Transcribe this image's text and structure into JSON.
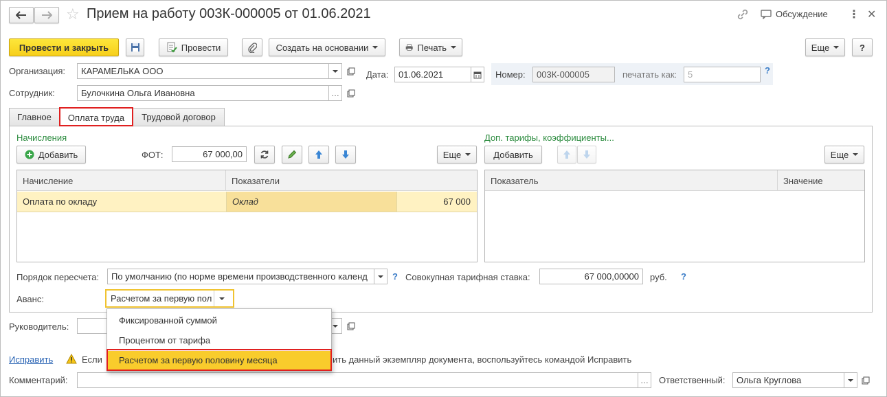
{
  "window": {
    "title": "Прием на работу 003К-000005 от 01.06.2021",
    "discussion_label": "Обсуждение"
  },
  "toolbar": {
    "post_close": "Провести и закрыть",
    "post": "Провести",
    "create_based": "Создать на основании",
    "print": "Печать",
    "more": "Еще",
    "help": "?"
  },
  "header": {
    "org_label": "Организация:",
    "org_value": "КАРАМЕЛЬКА ООО",
    "date_label": "Дата:",
    "date_value": "01.06.2021",
    "number_label": "Номер:",
    "number_value": "003К-000005",
    "print_as_label": "печатать как:",
    "print_as_value": "5",
    "help": "?",
    "employee_label": "Сотрудник:",
    "employee_value": "Булочкина Ольга Ивановна"
  },
  "tabs": [
    {
      "label": "Главное"
    },
    {
      "label": "Оплата труда"
    },
    {
      "label": "Трудовой договор"
    }
  ],
  "accruals": {
    "title": "Начисления",
    "add_label": "Добавить",
    "fot_label": "ФОТ:",
    "fot_value": "67 000,00",
    "more_label": "Еще",
    "columns": [
      "Начисление",
      "Показатели"
    ],
    "rows": [
      {
        "name": "Оплата по окладу",
        "indicator": "Оклад",
        "value": "67 000"
      }
    ]
  },
  "tariffs": {
    "title": "Доп. тарифы, коэффициенты...",
    "add_label": "Добавить",
    "more_label": "Еще",
    "columns": [
      "Показатель",
      "Значение"
    ]
  },
  "recalc": {
    "label": "Порядок пересчета:",
    "value": "По умолчанию (по норме времени производственного календ",
    "help": "?",
    "rate_label": "Совокупная тарифная ставка:",
    "rate_value": "67 000,00000",
    "currency": "руб.",
    "rate_help": "?"
  },
  "advance": {
    "label": "Аванс:",
    "value": "Расчетом за первую пол",
    "options": [
      "Фиксированной суммой",
      "Процентом от тарифа",
      "Расчетом за первую половину месяца"
    ]
  },
  "manager": {
    "label": "Руководитель:"
  },
  "fix": {
    "link": "Исправить",
    "warning_start": "Если",
    "warning_end": "ить данный экземпляр документа, воспользуйтесь командой Исправить"
  },
  "footer": {
    "comment_label": "Комментарий:",
    "comment_value": "",
    "responsible_label": "Ответственный:",
    "responsible_value": "Ольга Круглова"
  },
  "colors": {
    "accent_yellow": "#f9cc2c",
    "highlight_row": "#fff2c2",
    "red_frame": "#e02020",
    "green_title": "#2b8b3e",
    "link_blue": "#3a7cc7"
  }
}
